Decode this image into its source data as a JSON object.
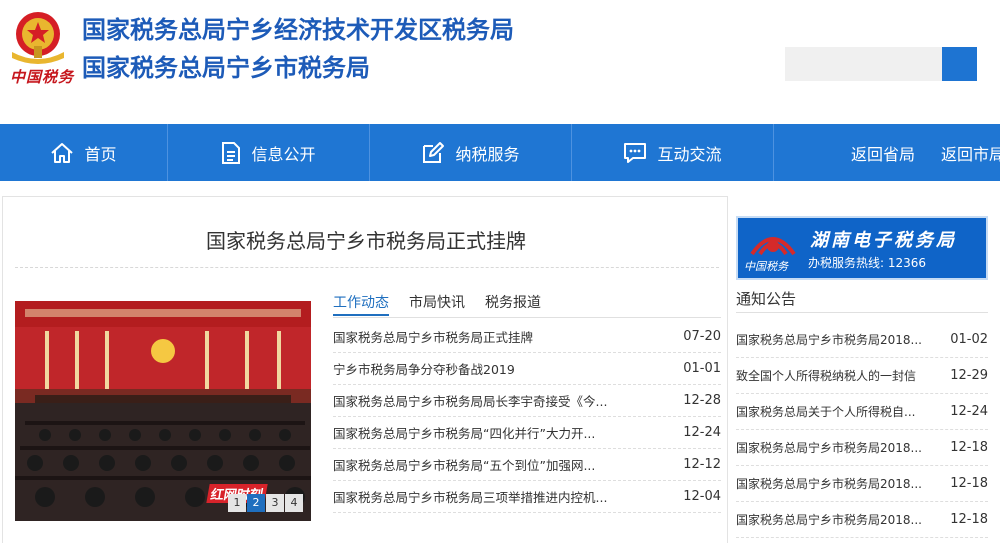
{
  "header": {
    "title_line1": "国家税务总局宁乡经济技术开发区税务局",
    "title_line2": "国家税务总局宁乡市税务局",
    "brand_script": "中国税务",
    "search": {
      "placeholder": ""
    }
  },
  "nav": {
    "items": [
      {
        "label": "首页",
        "icon": "home-icon"
      },
      {
        "label": "信息公开",
        "icon": "document-icon"
      },
      {
        "label": "纳税服务",
        "icon": "edit-icon"
      },
      {
        "label": "互动交流",
        "icon": "chat-icon"
      },
      {
        "label": "返回省局"
      },
      {
        "label": "返回市局"
      }
    ]
  },
  "main": {
    "headline": "国家税务总局宁乡市税务局正式挂牌",
    "photo_badge": "红网时刻",
    "carousel_pages": [
      "1",
      "2",
      "3",
      "4"
    ],
    "carousel_active": 2,
    "tabs": [
      {
        "label": "工作动态",
        "active": true
      },
      {
        "label": "市局快讯",
        "active": false
      },
      {
        "label": "税务报道",
        "active": false
      }
    ],
    "news": [
      {
        "title": "国家税务总局宁乡市税务局正式挂牌",
        "date": "07-20"
      },
      {
        "title": "宁乡市税务局争分夺秒备战2019",
        "date": "01-01"
      },
      {
        "title": "国家税务总局宁乡市税务局局长李宇奇接受《今...",
        "date": "12-28"
      },
      {
        "title": "国家税务总局宁乡市税务局“四化并行”大力开...",
        "date": "12-24"
      },
      {
        "title": "国家税务总局宁乡市税务局“五个到位”加强网...",
        "date": "12-12"
      },
      {
        "title": "国家税务总局宁乡市税务局三项举措推进内控机...",
        "date": "12-04"
      }
    ]
  },
  "sidebar": {
    "banner": {
      "title": "湖南电子税务局",
      "subtitle": "办税服务热线: 12366",
      "script": "中国税务"
    },
    "notice_title": "通知公告",
    "notices": [
      {
        "title": "国家税务总局宁乡市税务局2018...",
        "date": "01-02"
      },
      {
        "title": "致全国个人所得税纳税人的一封信",
        "date": "12-29"
      },
      {
        "title": "国家税务总局关于个人所得税自...",
        "date": "12-24"
      },
      {
        "title": "国家税务总局宁乡市税务局2018...",
        "date": "12-18"
      },
      {
        "title": "国家税务总局宁乡市税务局2018...",
        "date": "12-18"
      },
      {
        "title": "国家税务总局宁乡市税务局2018...",
        "date": "12-18"
      }
    ]
  },
  "colors": {
    "brand_blue": "#1f76d3",
    "title_blue": "#1d5bb8",
    "accent_red": "#c6161d"
  }
}
